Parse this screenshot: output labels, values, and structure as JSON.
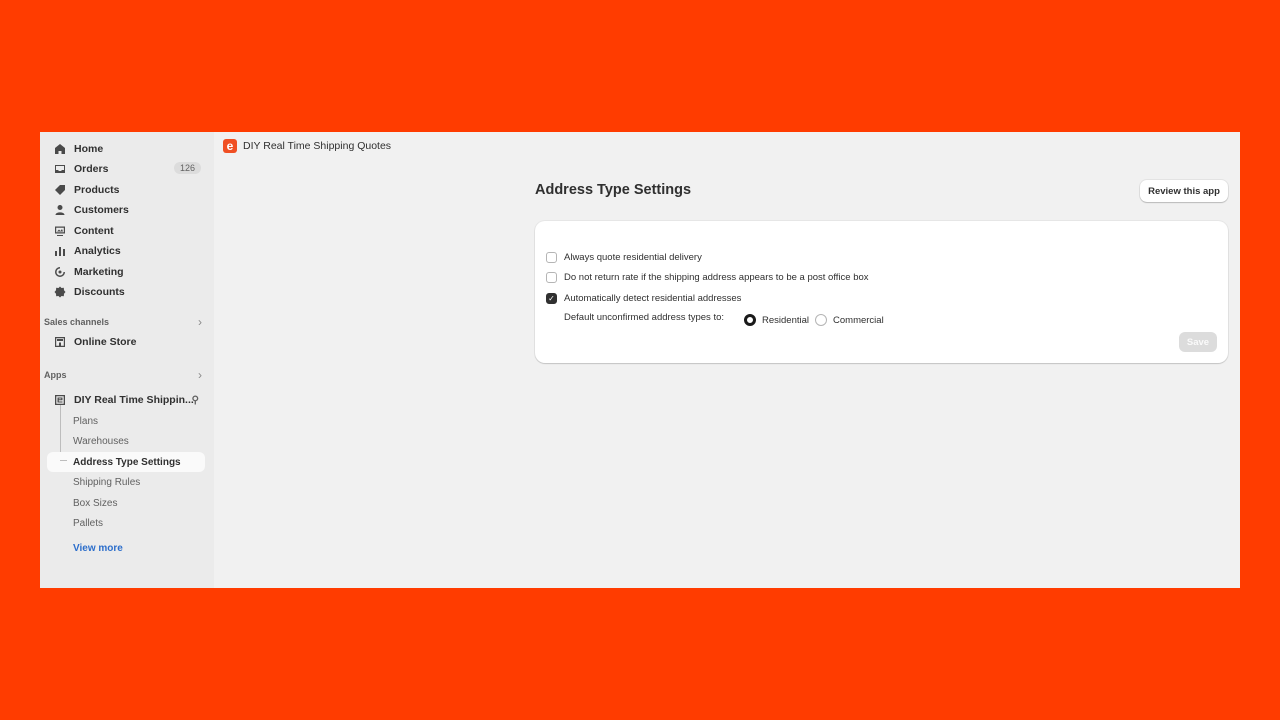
{
  "sidebar": {
    "nav": [
      {
        "label": "Home",
        "icon": "home-icon"
      },
      {
        "label": "Orders",
        "icon": "orders-icon",
        "badge": "126"
      },
      {
        "label": "Products",
        "icon": "tag-icon"
      },
      {
        "label": "Customers",
        "icon": "person-icon"
      },
      {
        "label": "Content",
        "icon": "content-icon"
      },
      {
        "label": "Analytics",
        "icon": "bar-chart-icon"
      },
      {
        "label": "Marketing",
        "icon": "target-icon"
      },
      {
        "label": "Discounts",
        "icon": "discount-icon"
      }
    ],
    "sales_channels": {
      "label": "Sales channels",
      "items": [
        {
          "label": "Online Store",
          "icon": "store-icon"
        }
      ]
    },
    "apps": {
      "label": "Apps",
      "app": {
        "label": "DIY Real Time Shippin...",
        "icon": "app-e-icon"
      },
      "sub_items": [
        "Plans",
        "Warehouses",
        "Address Type Settings",
        "Shipping Rules",
        "Box Sizes",
        "Pallets"
      ],
      "active_sub": "Address Type Settings"
    },
    "view_more": "View more"
  },
  "topbar": {
    "app_logo_letter": "e",
    "app_name": "DIY Real Time Shipping Quotes"
  },
  "page": {
    "title": "Address Type Settings",
    "review_button": "Review this app",
    "options": [
      {
        "label": "Always quote residential delivery",
        "checked": false
      },
      {
        "label": "Do not return rate if the shipping address appears to be a post office box",
        "checked": false
      },
      {
        "label": "Automatically detect residential addresses",
        "checked": true
      }
    ],
    "default_type": {
      "label": "Default unconfirmed address types to:",
      "options": [
        "Residential",
        "Commercial"
      ],
      "selected": "Residential"
    },
    "save_button": "Save"
  },
  "colors": {
    "background": "#ff3c00",
    "link": "#2c6ecb",
    "brand": "#f04f23"
  }
}
